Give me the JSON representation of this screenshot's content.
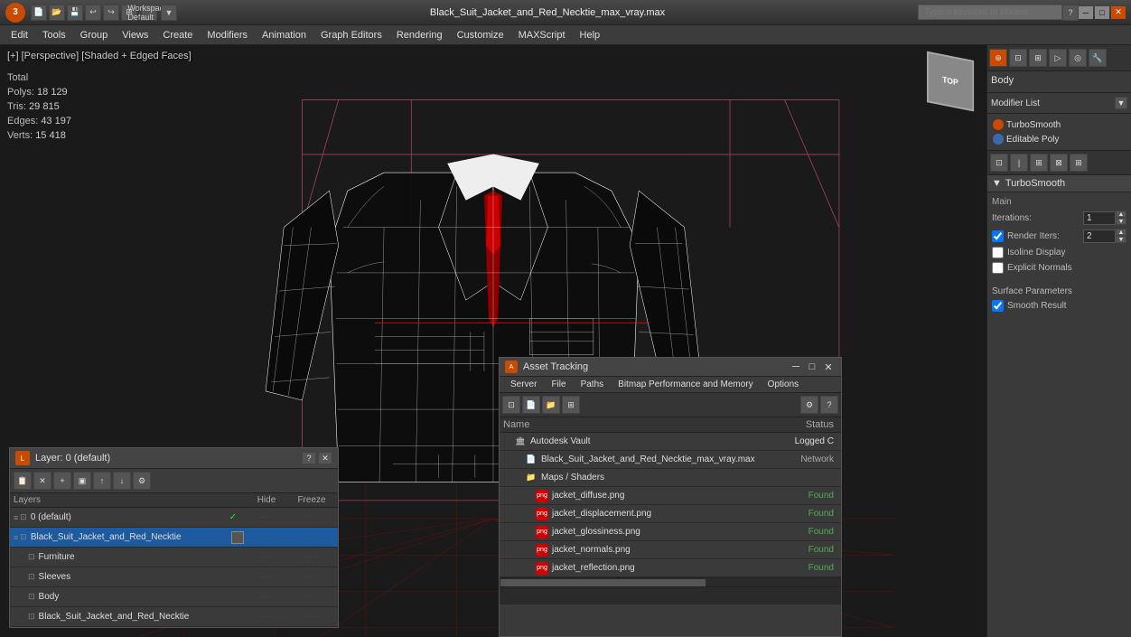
{
  "titlebar": {
    "logo": "3",
    "file_title": "Black_Suit_Jacket_and_Red_Necktie_max_vray.max",
    "search_placeholder": "Type a keyword or phrase",
    "workspace": "Workspace: Default"
  },
  "menubar": {
    "items": [
      "Edit",
      "Tools",
      "Group",
      "Views",
      "Create",
      "Modifiers",
      "Animation",
      "Graph Editors",
      "Rendering",
      "Customize",
      "MAXScript",
      "Help"
    ]
  },
  "viewport": {
    "label": "[+] [Perspective] [Shaded + Edged Faces]",
    "stats": {
      "polys_label": "Polys:",
      "polys_value": "18 129",
      "tris_label": "Tris:",
      "tris_value": "29 815",
      "edges_label": "Edges:",
      "edges_value": "43 197",
      "verts_label": "Verts:",
      "verts_value": "15 418",
      "total_label": "Total"
    }
  },
  "right_panel": {
    "modifier_list_label": "Modifier List",
    "modifiers": [
      {
        "name": "TurboSmooth",
        "color": "orange"
      },
      {
        "name": "Editable Poly",
        "color": "blue"
      }
    ],
    "body_label": "Body",
    "turbosmooth": {
      "title": "TurboSmooth",
      "main_label": "Main",
      "iterations_label": "Iterations:",
      "iterations_value": "1",
      "render_iters_label": "Render Iters:",
      "render_iters_value": "2",
      "isoline_label": "Isoline Display",
      "explicit_normals_label": "Explicit Normals",
      "surface_params_label": "Surface Parameters",
      "smooth_result_label": "Smooth Result"
    }
  },
  "layer_panel": {
    "title": "Layer: 0 (default)",
    "layers_label": "Layers",
    "hide_label": "Hide",
    "freeze_label": "Freeze",
    "layers": [
      {
        "name": "0 (default)",
        "indent": 0,
        "checked": true,
        "type": "default"
      },
      {
        "name": "Black_Suit_Jacket_and_Red_Necktie",
        "indent": 0,
        "selected": true,
        "type": "object"
      },
      {
        "name": "Furniture",
        "indent": 1,
        "type": "sub"
      },
      {
        "name": "Sleeves",
        "indent": 1,
        "type": "sub"
      },
      {
        "name": "Body",
        "indent": 1,
        "type": "sub"
      },
      {
        "name": "Black_Suit_Jacket_and_Red_Necktie",
        "indent": 1,
        "type": "sub"
      }
    ]
  },
  "asset_panel": {
    "title": "Asset Tracking",
    "menus": [
      "Server",
      "File",
      "Paths",
      "Bitmap Performance and Memory",
      "Options"
    ],
    "columns": {
      "name": "Name",
      "status": "Status"
    },
    "rows": [
      {
        "name": "Autodesk Vault",
        "indent": 1,
        "icon": "vault",
        "status": "Logged C",
        "status_class": ""
      },
      {
        "name": "Black_Suit_Jacket_and_Red_Necktie_max_vray.max",
        "indent": 2,
        "icon": "file",
        "status": "Network",
        "status_class": "network"
      },
      {
        "name": "Maps / Shaders",
        "indent": 2,
        "icon": "folder",
        "status": "",
        "status_class": ""
      },
      {
        "name": "jacket_diffuse.png",
        "indent": 3,
        "icon": "png",
        "status": "Found",
        "status_class": "found"
      },
      {
        "name": "jacket_displacement.png",
        "indent": 3,
        "icon": "png",
        "status": "Found",
        "status_class": "found"
      },
      {
        "name": "jacket_glossiness.png",
        "indent": 3,
        "icon": "png",
        "status": "Found",
        "status_class": "found"
      },
      {
        "name": "jacket_normals.png",
        "indent": 3,
        "icon": "png",
        "status": "Found",
        "status_class": "found"
      },
      {
        "name": "jacket_reflection.png",
        "indent": 3,
        "icon": "png",
        "status": "Found",
        "status_class": "found"
      }
    ]
  }
}
